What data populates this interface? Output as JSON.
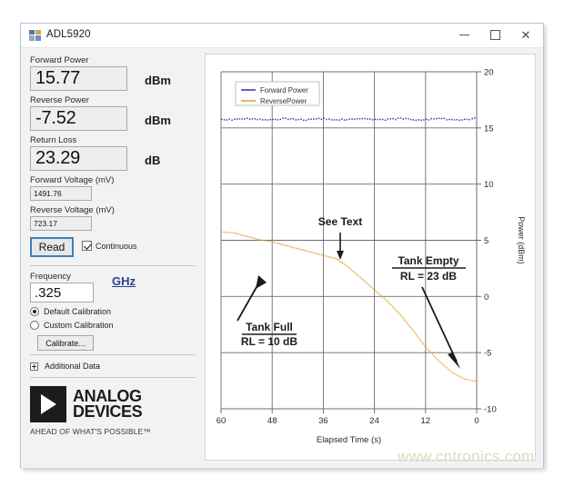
{
  "window": {
    "title": "ADL5920",
    "icon": "app-icon",
    "controls": {
      "minimize": "minimize-icon",
      "maximize": "maximize-icon",
      "close": "close-icon"
    }
  },
  "panel": {
    "forward_power": {
      "label": "Forward Power",
      "value": "15.77",
      "unit": "dBm"
    },
    "reverse_power": {
      "label": "Reverse Power",
      "value": "-7.52",
      "unit": "dBm"
    },
    "return_loss": {
      "label": "Return Loss",
      "value": "23.29",
      "unit": "dB"
    },
    "forward_voltage": {
      "label": "Forward Voltage (mV)",
      "value": "1491.76"
    },
    "reverse_voltage": {
      "label": "Reverse Voltage (mV)",
      "value": "723.17"
    },
    "read_button": "Read",
    "continuous": {
      "label": "Continuous",
      "checked": true
    },
    "frequency": {
      "label": "Frequency",
      "value": ".325",
      "unit_link": "GHz"
    },
    "calibration": {
      "default_label": "Default Calibration",
      "custom_label": "Custom Calibration",
      "selected": "default",
      "calibrate_button": "Calibrate..."
    },
    "additional_data": "Additional Data",
    "logo": {
      "line1": "ANALOG",
      "line2": "DEVICES",
      "tagline": "AHEAD OF WHAT'S POSSIBLE™"
    }
  },
  "watermark": "www.cntronics.com",
  "chart_data": {
    "type": "line",
    "title": "",
    "xlabel": "Elapsed Time (s)",
    "ylabel": "Power (dBm)",
    "xlim": [
      60,
      0
    ],
    "ylim": [
      -10,
      20
    ],
    "xticks": [
      60,
      48,
      36,
      24,
      12,
      0
    ],
    "yticks": [
      20,
      15,
      10,
      5,
      0,
      -5,
      -10
    ],
    "grid": true,
    "legend_position": "top-left",
    "x_axis_reversed": true,
    "series": [
      {
        "name": "Forward Power",
        "color": "#3b3f9e",
        "style": "dotted",
        "x": [
          60,
          57,
          54,
          51,
          48,
          45,
          42,
          39,
          36,
          33,
          30,
          27,
          24,
          21,
          18,
          15,
          12,
          9,
          6,
          3,
          0
        ],
        "values": [
          15.8,
          15.8,
          15.9,
          15.8,
          15.8,
          15.9,
          15.8,
          15.8,
          15.9,
          15.8,
          15.8,
          15.9,
          15.8,
          15.8,
          15.9,
          15.8,
          15.8,
          15.9,
          15.8,
          15.8,
          15.9
        ]
      },
      {
        "name": "ReversePower",
        "color": "#e8a33d",
        "style": "dotted",
        "x": [
          60,
          57,
          54,
          51,
          48,
          45,
          42,
          39,
          36,
          33,
          30,
          27,
          24,
          21,
          18,
          15,
          12,
          9,
          6,
          3,
          0
        ],
        "values": [
          5.8,
          5.7,
          5.4,
          5.1,
          4.9,
          4.6,
          4.3,
          4.0,
          3.7,
          3.4,
          2.6,
          1.6,
          0.6,
          -0.4,
          -1.6,
          -3.0,
          -4.5,
          -5.7,
          -6.7,
          -7.3,
          -7.5
        ]
      }
    ],
    "legend": [
      {
        "label": "Forward Power",
        "color": "#3b3f9e"
      },
      {
        "label": "ReversePower",
        "color": "#e8a33d"
      }
    ],
    "annotations": [
      {
        "name": "see-text",
        "line1": "See Text",
        "line2": "",
        "underline": false
      },
      {
        "name": "tank-full",
        "line1": "Tank Full",
        "line2": "RL = 10 dB",
        "underline": true
      },
      {
        "name": "tank-empty",
        "line1": "Tank Empty",
        "line2": "RL = 23 dB",
        "underline": true
      }
    ]
  }
}
